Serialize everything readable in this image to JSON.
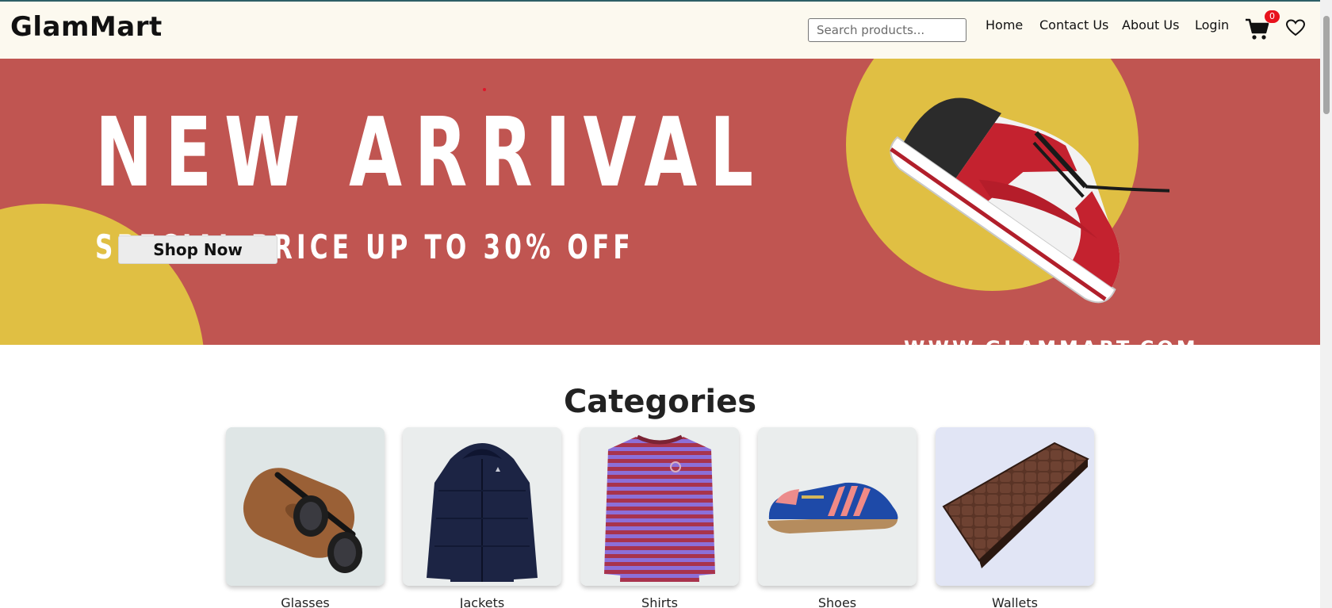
{
  "header": {
    "logo": "GlamMart",
    "search_placeholder": "Search products...",
    "nav": {
      "home": "Home",
      "contact": "Contact Us",
      "about": "About Us",
      "login": "Login"
    },
    "cart_count": "0",
    "icons": [
      "cart-icon",
      "heart-icon"
    ]
  },
  "banner": {
    "headline": "NEW ARRIVAL",
    "subline": "SPECIAL PRICE UP TO 30% OFF",
    "website": "WWW.GLAMMART.COM",
    "button_label": "Shop Now",
    "colors": {
      "background": "#c05551",
      "accent": "#e0bf43",
      "text": "#ffffff"
    }
  },
  "categories": {
    "title": "Categories",
    "items": [
      {
        "label": "Glasses",
        "bg": "#dfe6e6"
      },
      {
        "label": "Jackets",
        "bg": "#eaeded"
      },
      {
        "label": "Shirts",
        "bg": "#eaeded"
      },
      {
        "label": "Shoes",
        "bg": "#eaeded"
      },
      {
        "label": "Wallets",
        "bg": "#e1e5f5"
      }
    ]
  }
}
